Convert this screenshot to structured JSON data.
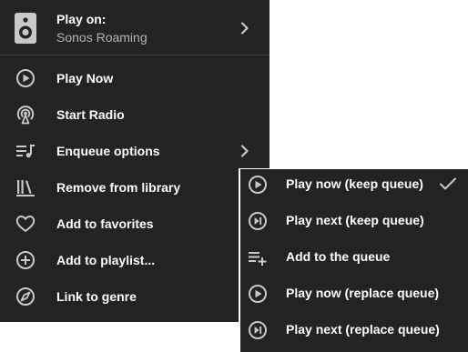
{
  "header": {
    "title": "Play on:",
    "subtitle": "Sonos Roaming",
    "icon": "speaker-icon"
  },
  "menu": {
    "items": [
      {
        "label": "Play Now",
        "icon": "play-circle-icon"
      },
      {
        "label": "Start Radio",
        "icon": "radio-icon"
      },
      {
        "label": "Enqueue options",
        "icon": "queue-music-icon",
        "has_submenu": true
      },
      {
        "label": "Remove from library",
        "icon": "library-icon"
      },
      {
        "label": "Add to favorites",
        "icon": "heart-icon"
      },
      {
        "label": "Add to playlist...",
        "icon": "add-circle-icon"
      },
      {
        "label": "Link to genre",
        "icon": "compass-icon"
      }
    ]
  },
  "submenu": {
    "items": [
      {
        "label": "Play now (keep queue)",
        "icon": "play-circle-icon",
        "selected": true
      },
      {
        "label": "Play next (keep queue)",
        "icon": "skip-next-circle-icon"
      },
      {
        "label": "Add to the queue",
        "icon": "playlist-add-icon"
      },
      {
        "label": "Play now (replace queue)",
        "icon": "play-circle-icon"
      },
      {
        "label": "Play next (replace queue)",
        "icon": "skip-next-circle-icon"
      }
    ]
  },
  "colors": {
    "menu_bg": "#232323",
    "text_primary": "#ffffff",
    "text_secondary": "#b4b4b4",
    "icon": "#c8c8c8",
    "divider": "#3a3a3a"
  }
}
